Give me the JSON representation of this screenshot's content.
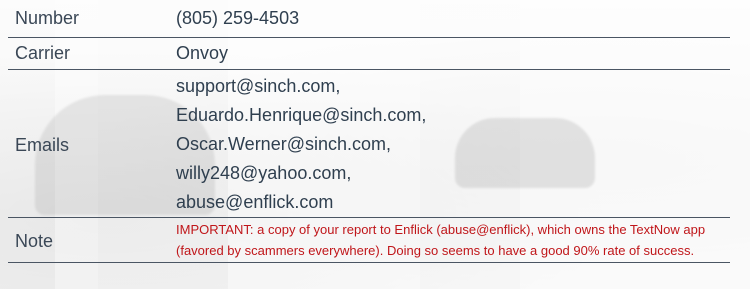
{
  "details": {
    "number": {
      "label": "Number",
      "value": "(805) 259-4503"
    },
    "carrier": {
      "label": "Carrier",
      "value": "Onvoy"
    },
    "emails": {
      "label": "Emails",
      "values": [
        "support@sinch.com,",
        "Eduardo.Henrique@sinch.com,",
        "Oscar.Werner@sinch.com,",
        "willy248@yahoo.com,",
        "abuse@enflick.com"
      ]
    },
    "note": {
      "label": "Note",
      "value": "IMPORTANT: a copy of your report to Enflick (abuse@enflick), which owns the TextNow app (favored by scammers everywhere). Doing so seems to have a good 90% rate of success."
    }
  },
  "colors": {
    "text": "#2f3f4f",
    "label": "#3a4756",
    "divider": "#4a5563",
    "note": "#c0161a"
  }
}
